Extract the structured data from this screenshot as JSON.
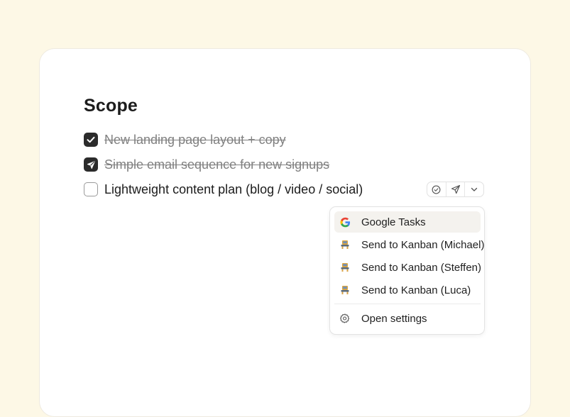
{
  "page": {
    "title": "Scope"
  },
  "tasks": [
    {
      "label": "New landing page layout + copy",
      "state": "done"
    },
    {
      "label": "Simple email sequence for new signups",
      "state": "sent"
    },
    {
      "label": "Lightweight content plan (blog / video / social)",
      "state": "open"
    }
  ],
  "toolbar": {
    "icons": [
      "check-circle-icon",
      "send-icon",
      "chevron-down-icon"
    ]
  },
  "menu": {
    "items": [
      {
        "label": "Google Tasks",
        "icon": "google-icon"
      },
      {
        "label": "Send to Kanban (Michael)",
        "icon": "kanban-icon"
      },
      {
        "label": "Send to Kanban (Steffen)",
        "icon": "kanban-icon"
      },
      {
        "label": "Send to Kanban (Luca)",
        "icon": "kanban-icon"
      }
    ],
    "settings_label": "Open settings",
    "settings_icon": "gear-icon"
  },
  "colors": {
    "background": "#fdf8e6",
    "card": "#ffffff",
    "checkbox_checked": "#2b2b2b",
    "struck_text": "#808080",
    "menu_highlight": "#f4f2ee"
  }
}
